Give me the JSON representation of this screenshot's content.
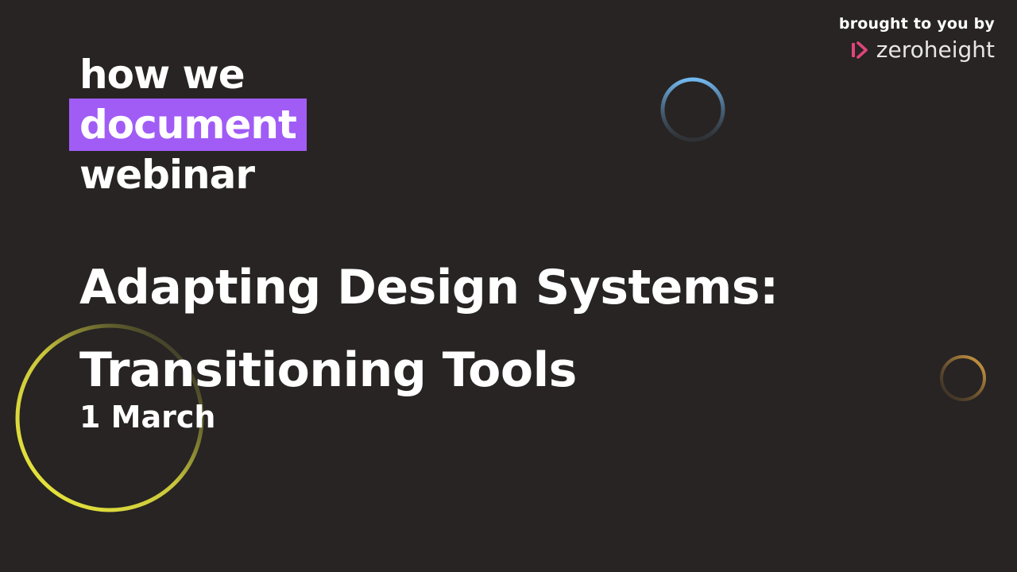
{
  "brand": {
    "tagline": "brought to you by",
    "name": "zeroheight",
    "logo_icon": "zeroheight-logo-icon",
    "logo_color": "#e0457b"
  },
  "series": {
    "line1": "how we",
    "line2": "document",
    "line3": "webinar",
    "highlight_color": "#a15cf6"
  },
  "talk": {
    "title_line1": "Adapting Design Systems:",
    "title_line2": "Transitioning Tools",
    "date": "1 March"
  },
  "colors": {
    "background": "#272423",
    "text": "#ffffff",
    "ring_blue": "#6bb4ee",
    "ring_yellow": "#e8e542",
    "ring_orange": "#d9a040"
  }
}
